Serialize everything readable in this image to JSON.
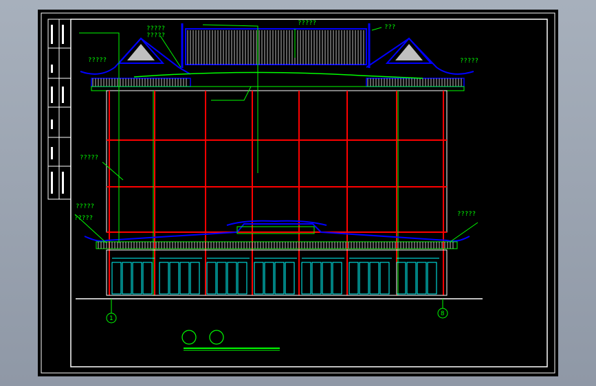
{
  "labels": {
    "roof_ridge": "?????",
    "left_gable_a": "?????",
    "left_gable_b": "?????",
    "right_top": "???",
    "left_eave": "?????",
    "right_eave": "?????",
    "left_wall": "?????",
    "left_lower_a": "?????",
    "left_lower_b": "?????",
    "right_lower": "?????"
  },
  "axes": {
    "left": "1",
    "right": "8"
  },
  "colors": {
    "background": "#000000",
    "frame": "#ffffff",
    "annotation": "#00ff00",
    "column": "#ff0000",
    "roof_outline": "#0000ff",
    "tile": "#ffffff",
    "glass": "#00ffff"
  }
}
